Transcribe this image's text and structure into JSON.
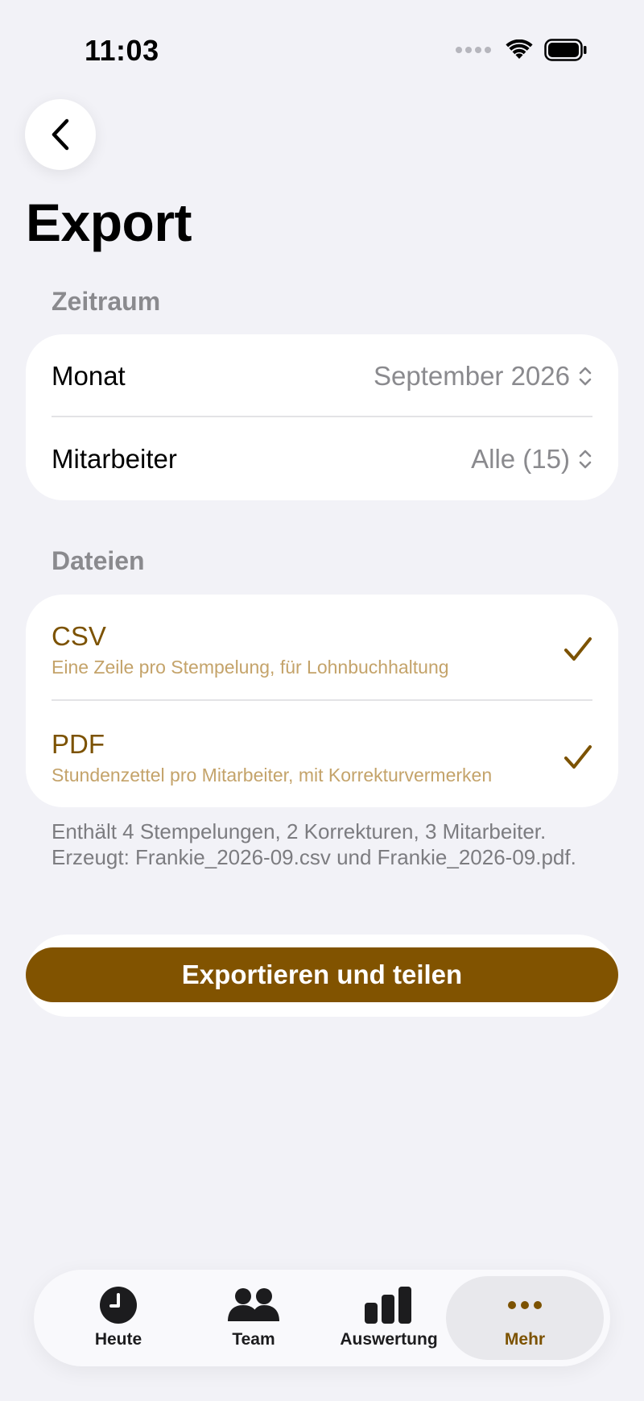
{
  "status_bar": {
    "time": "11:03"
  },
  "header": {
    "title": "Export"
  },
  "zeitraum": {
    "section_label": "Zeitraum",
    "rows": [
      {
        "label": "Monat",
        "value": "September 2026"
      },
      {
        "label": "Mitarbeiter",
        "value": "Alle (15)"
      }
    ]
  },
  "dateien": {
    "section_label": "Dateien",
    "files": [
      {
        "title": "CSV",
        "subtitle": "Eine Zeile pro Stempelung, für Lohnbuchhaltung",
        "checked": true
      },
      {
        "title": "PDF",
        "subtitle": "Stundenzettel pro Mitarbeiter, mit Korrekturvermerken",
        "checked": true
      }
    ],
    "footnote": "Enthält 4 Stempelungen, 2 Korrekturen, 3 Mitarbeiter. Erzeugt: Frankie_2026-09.csv und Frankie_2026-09.pdf."
  },
  "actions": {
    "export_label": "Exportieren und teilen"
  },
  "tab_bar": {
    "tabs": [
      {
        "label": "Heute",
        "icon": "clock-icon",
        "active": false
      },
      {
        "label": "Team",
        "icon": "people-icon",
        "active": false
      },
      {
        "label": "Auswertung",
        "icon": "bar-chart-icon",
        "active": false
      },
      {
        "label": "Mehr",
        "icon": "ellipsis-icon",
        "active": true
      }
    ]
  },
  "colors": {
    "accent": "#815300",
    "accent_text": "#7c5200",
    "accent_soft": "#c4a36a",
    "background": "#f2f2f7"
  }
}
